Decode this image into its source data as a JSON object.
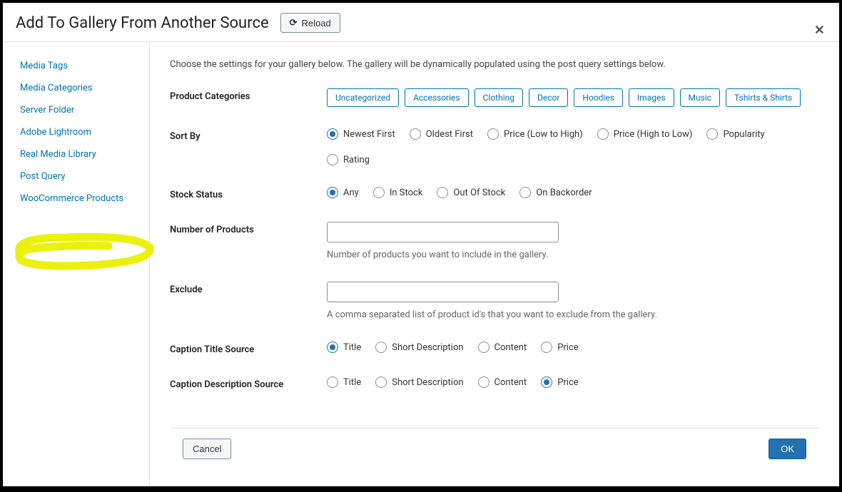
{
  "header": {
    "title": "Add To Gallery From Another Source",
    "reload_label": "Reload"
  },
  "sidebar": {
    "items": [
      {
        "label": "Media Tags"
      },
      {
        "label": "Media Categories"
      },
      {
        "label": "Server Folder"
      },
      {
        "label": "Adobe Lightroom"
      },
      {
        "label": "Real Media Library"
      },
      {
        "label": "Post Query"
      },
      {
        "label": "WooCommerce Products"
      }
    ]
  },
  "intro_text": "Choose the settings for your gallery below. The gallery will be dynamically populated using the post query settings below.",
  "form": {
    "product_categories": {
      "label": "Product Categories",
      "options": [
        "Uncategorized",
        "Accessories",
        "Clothing",
        "Decor",
        "Hoodies",
        "Images",
        "Music",
        "Tshirts & Shirts"
      ]
    },
    "sort_by": {
      "label": "Sort By",
      "options": [
        "Newest First",
        "Oldest First",
        "Price (Low to High)",
        "Price (High to Low)",
        "Popularity",
        "Rating"
      ],
      "selected": "Newest First"
    },
    "stock_status": {
      "label": "Stock Status",
      "options": [
        "Any",
        "In Stock",
        "Out Of Stock",
        "On Backorder"
      ],
      "selected": "Any"
    },
    "number_of_products": {
      "label": "Number of Products",
      "value": "",
      "help": "Number of products you want to include in the gallery."
    },
    "exclude": {
      "label": "Exclude",
      "value": "",
      "help": "A comma separated list of product id's that you want to exclude from the gallery."
    },
    "caption_title_source": {
      "label": "Caption Title Source",
      "options": [
        "Title",
        "Short Description",
        "Content",
        "Price"
      ],
      "selected": "Title"
    },
    "caption_description_source": {
      "label": "Caption Description Source",
      "options": [
        "Title",
        "Short Description",
        "Content",
        "Price"
      ],
      "selected": "Price"
    }
  },
  "footer": {
    "cancel_label": "Cancel",
    "ok_label": "OK"
  }
}
